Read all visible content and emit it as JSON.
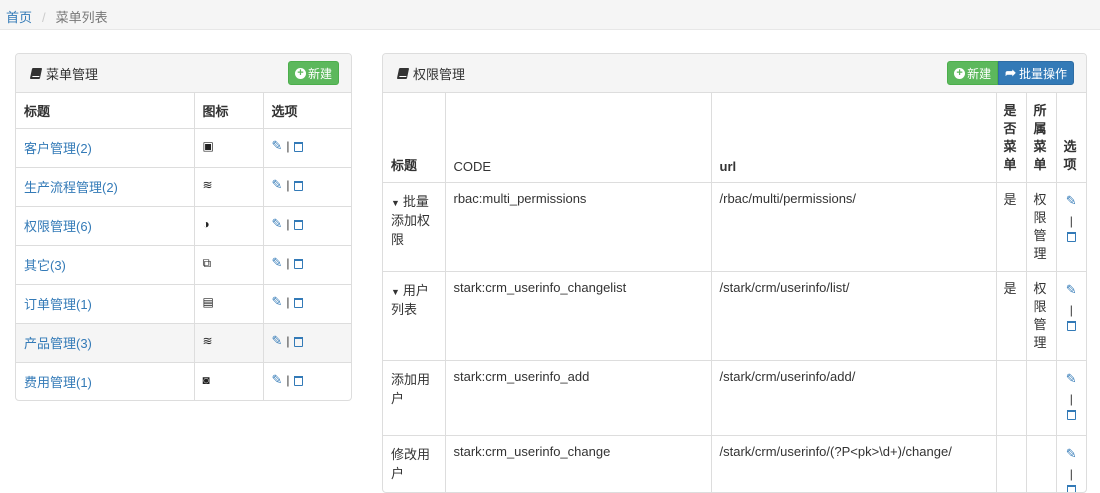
{
  "breadcrumb": {
    "home": "首页",
    "separator": "/",
    "current": "菜单列表"
  },
  "menu_panel": {
    "title": "菜单管理",
    "new_button": "新建",
    "headers": [
      "标题",
      "图标",
      "选项"
    ],
    "rows": [
      {
        "title": "客户管理(2)",
        "icon": "contact-card-icon"
      },
      {
        "title": "生产流程管理(2)",
        "icon": "stack-icon"
      },
      {
        "title": "权限管理(6)",
        "icon": "adjust-icon"
      },
      {
        "title": "其它(3)",
        "icon": "copy-icon"
      },
      {
        "title": "订单管理(1)",
        "icon": "id-card-icon"
      },
      {
        "title": "产品管理(3)",
        "icon": "stack-icon"
      },
      {
        "title": "费用管理(1)",
        "icon": "id-badge-icon"
      }
    ],
    "highlight_row": 5
  },
  "perm_panel": {
    "title": "权限管理",
    "new_button": "新建",
    "batch_button": "批量操作",
    "headers": {
      "title": "标题",
      "code": "CODE",
      "url": "url",
      "is_menu": "是否菜单",
      "parent_menu": "所属菜单",
      "options": "选项"
    },
    "rows": [
      {
        "title": "批量添加权限",
        "expandable": true,
        "code": "rbac:multi_permissions",
        "url": "/rbac/multi/permissions/",
        "is_menu": "是",
        "parent_menu": "权限管理"
      },
      {
        "title": "用户列表",
        "expandable": true,
        "code": "stark:crm_userinfo_changelist",
        "url": "/stark/crm/userinfo/list/",
        "is_menu": "是",
        "parent_menu": "权限管理"
      },
      {
        "title": "添加用户",
        "expandable": false,
        "code": "stark:crm_userinfo_add",
        "url": "/stark/crm/userinfo/add/",
        "is_menu": "",
        "parent_menu": ""
      },
      {
        "title": "修改用户",
        "expandable": false,
        "code": "stark:crm_userinfo_change",
        "url": "/stark/crm/userinfo/(?P<pk>\\d+)/change/",
        "is_menu": "",
        "parent_menu": ""
      }
    ]
  },
  "option_icons": {
    "edit": "pencil-icon",
    "delete": "trash-icon",
    "divider": "|"
  },
  "colors": {
    "link": "#337ab7",
    "success": "#5cb85c",
    "primary": "#337ab7",
    "heading_bg": "#f5f5f5"
  }
}
